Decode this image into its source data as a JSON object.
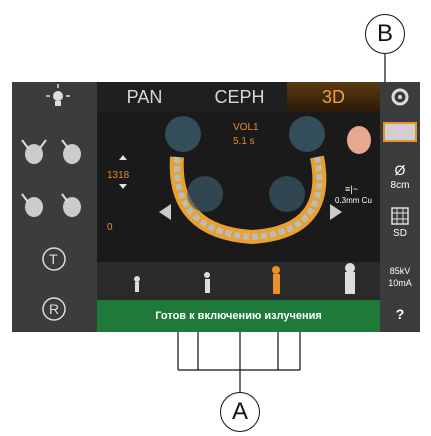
{
  "tabs": [
    "PAN",
    "CEPH",
    "3D"
  ],
  "volume": {
    "name": "VOL1",
    "time": "5.1 s"
  },
  "left_values": {
    "height": "1318",
    "offset": "0"
  },
  "filter": {
    "label": "0.3mm Cu",
    "symbol": "≡|~"
  },
  "right_panel": {
    "diameter": "8cm",
    "resolution": "SD",
    "kv": "85kV",
    "ma": "10mA",
    "help": "?"
  },
  "status": "Готов к включению излучения",
  "callouts": {
    "a": "A",
    "b": "B"
  },
  "left_buttons": {
    "t": "T",
    "r": "R"
  },
  "symbols": {
    "diameter": "Ø"
  }
}
